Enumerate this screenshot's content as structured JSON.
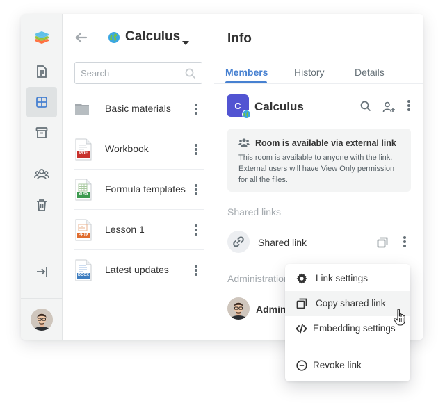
{
  "colors": {
    "accent": "#4781d1",
    "room_logo": "#5254d2",
    "pdf": "#c8302b",
    "xlsx": "#3c9a4f",
    "pptx": "#e06c2e",
    "docx": "#3f7ec0",
    "folder": "#a3a9ae"
  },
  "sidebar": {
    "items": [
      {
        "icon": "document-icon"
      },
      {
        "icon": "rooms-grid-icon",
        "active": true
      },
      {
        "icon": "archive-icon"
      },
      {
        "icon": "people-icon"
      },
      {
        "icon": "trash-icon"
      },
      {
        "icon": "sign-out-icon"
      }
    ]
  },
  "room": {
    "title": "Calculus",
    "logo_letter": "C"
  },
  "search": {
    "placeholder": "Search"
  },
  "files": [
    {
      "name": "Basic materials",
      "type": "folder"
    },
    {
      "name": "Workbook",
      "type": "pdf",
      "badge": "PDF"
    },
    {
      "name": "Formula templates",
      "type": "xlsx",
      "badge": "XLSX"
    },
    {
      "name": "Lesson 1",
      "type": "pptx",
      "badge": "PPTX"
    },
    {
      "name": "Latest updates",
      "type": "docx",
      "badge": "DOCX"
    }
  ],
  "info": {
    "title": "Info",
    "tabs": [
      {
        "label": "Members",
        "active": true
      },
      {
        "label": "History"
      },
      {
        "label": "Details"
      }
    ],
    "room_name": "Calculus",
    "notice": {
      "title": "Room is available via external link",
      "text": "This room is available to anyone with the link. External users will have View Only permission for all the files."
    },
    "shared_links_label": "Shared links",
    "shared_link_label": "Shared link",
    "administration_label": "Administration",
    "admin_name": "Admin"
  },
  "menu": {
    "items": [
      {
        "label": "Link settings",
        "icon": "gear-icon"
      },
      {
        "label": "Copy shared link",
        "icon": "copy-icon",
        "hover": true
      },
      {
        "label": "Embedding settings",
        "icon": "code-icon"
      },
      {
        "label": "Revoke link",
        "icon": "minus-circle-icon"
      }
    ]
  }
}
